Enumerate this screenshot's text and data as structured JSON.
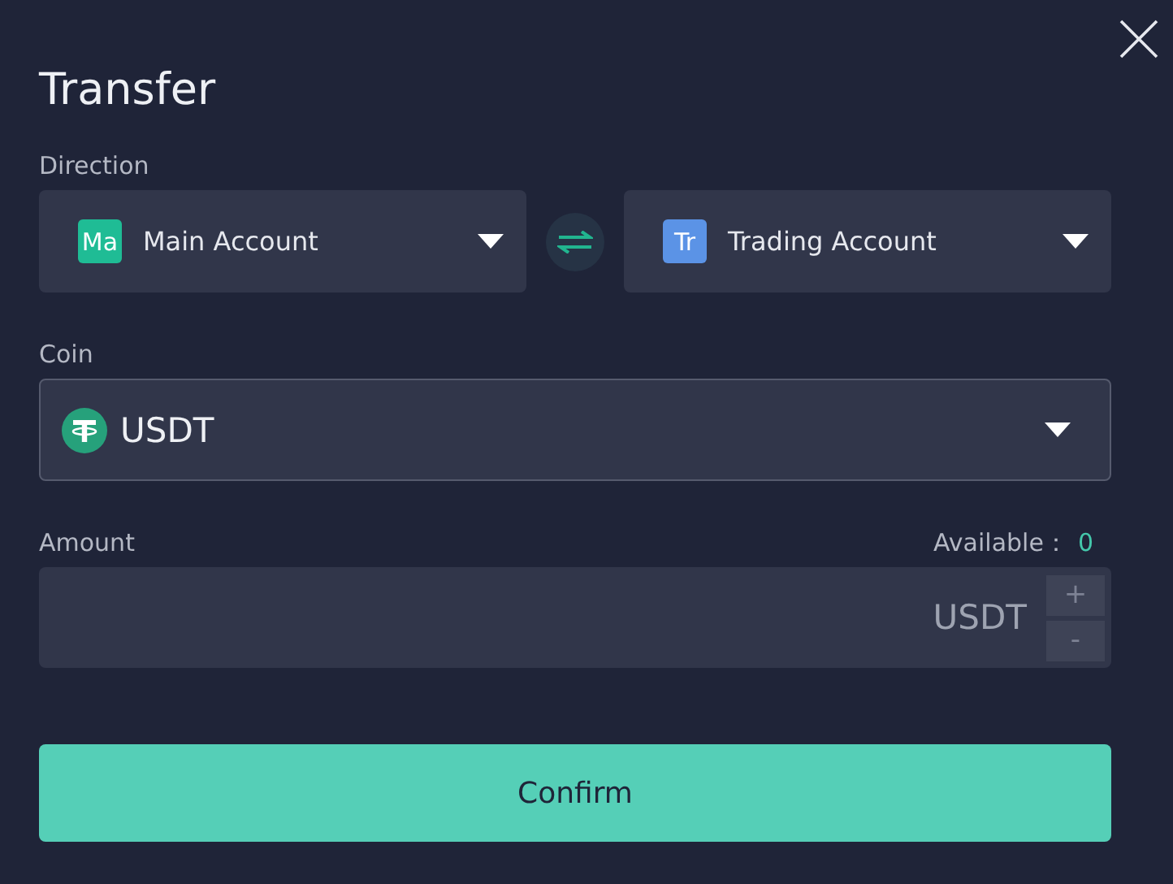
{
  "dialog": {
    "title": "Transfer"
  },
  "direction": {
    "label": "Direction",
    "accounts": [
      {
        "badge": "Ma",
        "name": "Main Account",
        "color": "#1fbc95"
      },
      {
        "badge": "Tr",
        "name": "Trading Account",
        "color": "#5b93e6"
      }
    ]
  },
  "coin": {
    "label": "Coin",
    "value": "USDT"
  },
  "amount": {
    "label": "Amount",
    "available_label": "Available：",
    "available_value": "0",
    "unit": "USDT",
    "increment": "+",
    "decrement": "-"
  },
  "buttons": [
    {
      "label": "Confirm"
    }
  ]
}
